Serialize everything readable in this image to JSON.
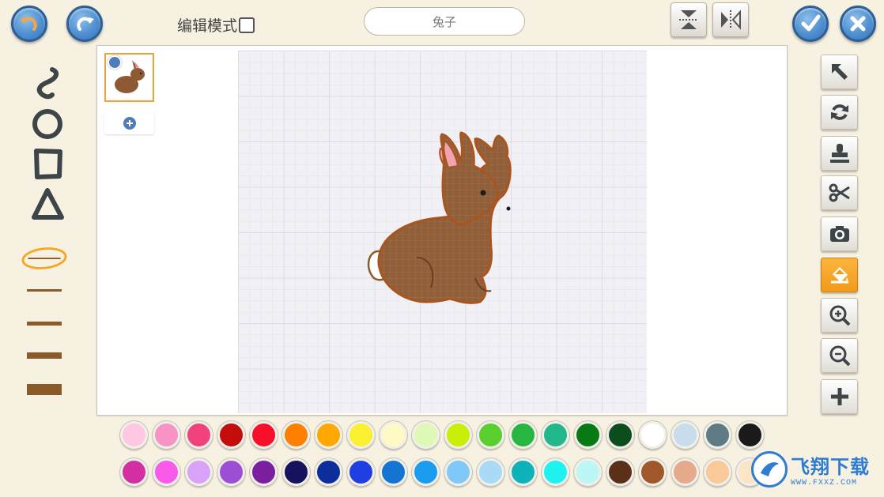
{
  "header": {
    "edit_mode_label": "编辑模式",
    "edit_mode_checked": false,
    "sprite_name": "兔子"
  },
  "icons": {
    "undo": "undo-arrow-icon",
    "redo": "redo-arrow-icon",
    "flip_vertical": "flip-vertical-icon",
    "flip_horizontal": "flip-horizontal-icon",
    "confirm": "checkmark-icon",
    "close": "close-x-icon"
  },
  "left_tools": [
    {
      "name": "brush-tool",
      "icon": "squiggle-icon"
    },
    {
      "name": "ellipse-tool",
      "icon": "circle-icon"
    },
    {
      "name": "rectangle-tool",
      "icon": "square-icon"
    },
    {
      "name": "triangle-tool",
      "icon": "triangle-icon"
    }
  ],
  "stroke_widths": [
    "thin",
    "small",
    "medium",
    "large"
  ],
  "selected_stroke_width": "thin",
  "right_tools": [
    {
      "name": "select-tool",
      "icon": "arrow-cursor-icon",
      "active": false
    },
    {
      "name": "rotate-tool",
      "icon": "rotate-icon",
      "active": false
    },
    {
      "name": "stamp-tool",
      "icon": "stamp-icon",
      "active": false
    },
    {
      "name": "cut-tool",
      "icon": "scissors-icon",
      "active": false
    },
    {
      "name": "camera-tool",
      "icon": "camera-icon",
      "active": false
    },
    {
      "name": "fill-tool",
      "icon": "paint-bucket-icon",
      "active": true
    },
    {
      "name": "zoom-in-tool",
      "icon": "zoom-in-icon",
      "active": false
    },
    {
      "name": "zoom-out-tool",
      "icon": "zoom-out-icon",
      "active": false
    },
    {
      "name": "add-tool",
      "icon": "plus-icon",
      "active": false
    }
  ],
  "palette_row1": [
    "#ffc7e1",
    "#f893c5",
    "#f0427c",
    "#c40c0c",
    "#fa0f2a",
    "#ff7f00",
    "#ffa800",
    "#fbf02f",
    "#fff9c4",
    "#def8b6",
    "#c9ee0a",
    "#5ad02e",
    "#28b642",
    "#21b78a",
    "#087a14",
    "#0c4d1d",
    "#ffffff",
    "#c8dcec",
    "#5e7a82",
    "#1a1a1a"
  ],
  "palette_row2": [
    "#d42ea3",
    "#fa5ae9",
    "#d9a2f8",
    "#9c4fd4",
    "#7a1fa0",
    "#17125e",
    "#0b2e9a",
    "#1f3fe3",
    "#1374d2",
    "#1a9cf0",
    "#7fc8f8",
    "#a9dbf7",
    "#10b2b9",
    "#1ef2ee",
    "#bcf7f5",
    "#5a3018",
    "#a0582b",
    "#e5a98c",
    "#f9c998",
    "#fce5c6"
  ],
  "watermark": {
    "title": "飞翔下载",
    "url": "WWW.FXXZ.COM"
  }
}
